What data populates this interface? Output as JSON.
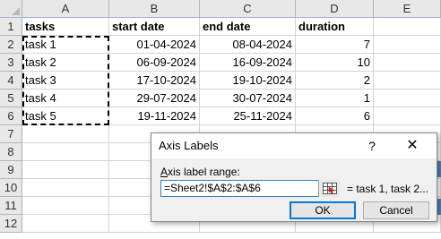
{
  "spreadsheet": {
    "columns": [
      "A",
      "B",
      "C",
      "D",
      "E"
    ],
    "rows": [
      "1",
      "2",
      "3",
      "4",
      "5",
      "6",
      "7",
      "8",
      "9",
      "10",
      "11",
      "12"
    ],
    "data": [
      [
        "tasks",
        "start date",
        "end date",
        "duration"
      ],
      [
        "task 1",
        "01-04-2024",
        "08-04-2024",
        "7"
      ],
      [
        "task 2",
        "06-09-2024",
        "16-09-2024",
        "10"
      ],
      [
        "task 3",
        "17-10-2024",
        "19-10-2024",
        "2"
      ],
      [
        "task 4",
        "29-07-2024",
        "30-07-2024",
        "1"
      ],
      [
        "task 5",
        "19-11-2024",
        "25-11-2024",
        "6"
      ]
    ]
  },
  "dialog": {
    "title": "Axis Labels",
    "help_label": "?",
    "close_label": "✕",
    "range_label_prefix": "A",
    "range_label_rest": "xis label range:",
    "range_value": "=Sheet2!$A$2:$A$6",
    "preview": "= task 1, task 2...",
    "ok_label": "OK",
    "cancel_label": "Cancel"
  },
  "colors": {
    "selection_border": "#000000",
    "ok_focus": "#0078d7",
    "input_border": "#3c7fb1",
    "chart_behind": "#4f81bd"
  }
}
